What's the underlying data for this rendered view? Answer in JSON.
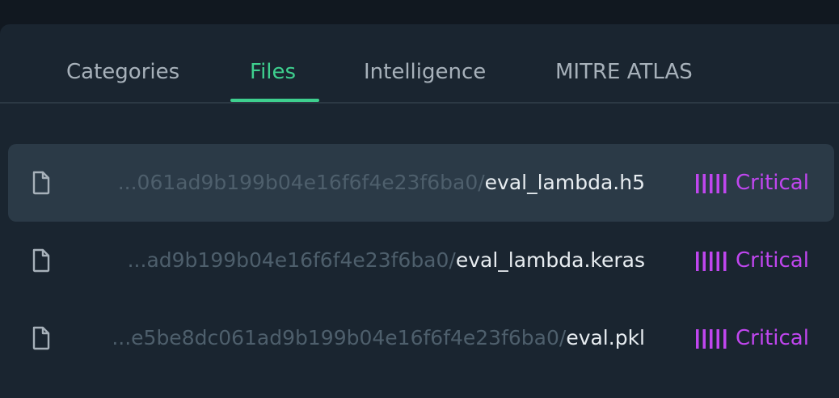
{
  "tabs": [
    {
      "label": "Categories",
      "active": false
    },
    {
      "label": "Files",
      "active": true
    },
    {
      "label": "Intelligence",
      "active": false
    },
    {
      "label": "MITRE ATLAS",
      "active": false
    }
  ],
  "files": [
    {
      "path_prefix": "...061ad9b199b04e16f6f4e23f6ba0/",
      "file_name": "eval_lambda.h5",
      "severity": "Critical",
      "selected": true,
      "icon": "file-icon"
    },
    {
      "path_prefix": "...ad9b199b04e16f6f4e23f6ba0/",
      "file_name": "eval_lambda.keras",
      "severity": "Critical",
      "selected": false,
      "icon": "file-icon"
    },
    {
      "path_prefix": "...e5be8dc061ad9b199b04e16f6f4e23f6ba0/",
      "file_name": "eval.pkl",
      "severity": "Critical",
      "selected": false,
      "icon": "file-icon"
    }
  ],
  "colors": {
    "active_tab": "#3ecf8e",
    "severity_critical": "#c046ef",
    "selected_row": "#2b3a47"
  }
}
